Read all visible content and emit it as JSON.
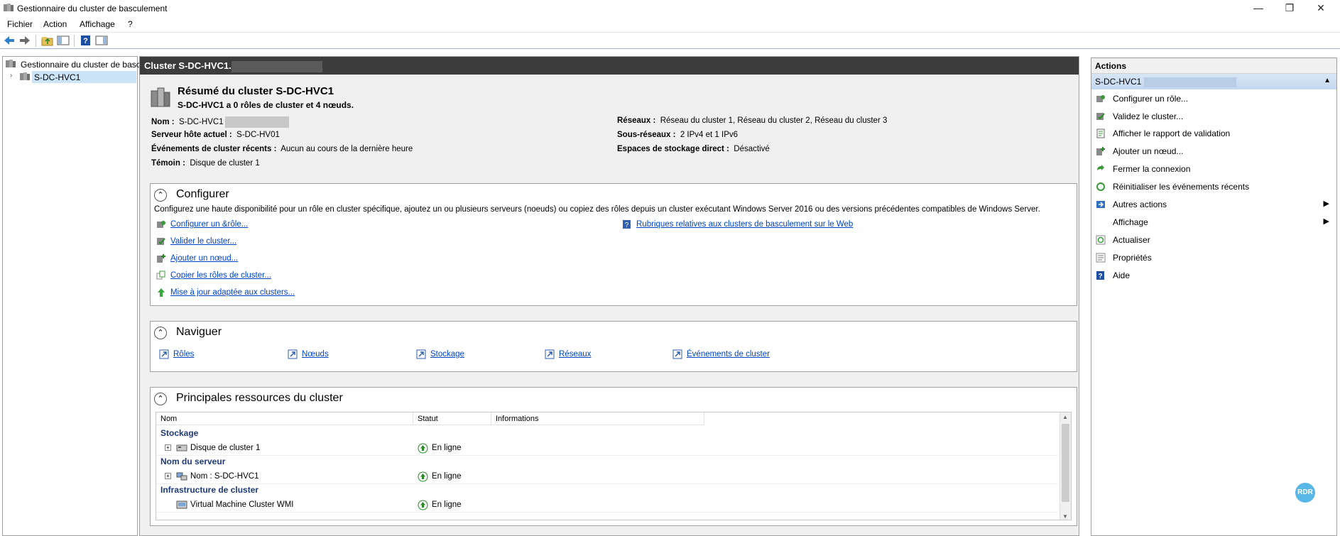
{
  "window": {
    "title": "Gestionnaire du cluster de basculement"
  },
  "menu": [
    "Fichier",
    "Action",
    "Affichage",
    "?"
  ],
  "tree": {
    "root": "Gestionnaire du cluster de basc",
    "child": "S-DC-HVC1"
  },
  "center": {
    "header": "Cluster S-DC-HVC1.",
    "summary_title": "Résumé du cluster S-DC-HVC1",
    "summary_sub": "S-DC-HVC1 a 0 rôles de cluster et 4 nœuds.",
    "left_fields": [
      {
        "k": "Nom :",
        "v": "S-DC-HVC1"
      },
      {
        "k": "Serveur hôte actuel :",
        "v": "S-DC-HV01"
      },
      {
        "k": "Événements de cluster récents :",
        "v": "Aucun au cours de la dernière heure"
      },
      {
        "k": "Témoin :",
        "v": "Disque de cluster 1"
      }
    ],
    "right_fields": [
      {
        "k": "Réseaux :",
        "v": "Réseau du cluster 1, Réseau du cluster 2, Réseau du cluster 3"
      },
      {
        "k": "Sous-réseaux :",
        "v": "2 IPv4 et 1 IPv6"
      },
      {
        "k": "Espaces de stockage direct :",
        "v": "Désactivé"
      }
    ],
    "configure": {
      "title": "Configurer",
      "desc": "Configurez une haute disponibilité pour un rôle en cluster spécifique, ajoutez un ou plusieurs serveurs (noeuds) ou copiez des rôles depuis un cluster exécutant Windows Server 2016 ou des versions précédentes compatibles de Windows Server.",
      "links": [
        "Configurer un &rôle...",
        "Valider le cluster...",
        "Ajouter un nœud...",
        "Copier les rôles de cluster...",
        "Mise à jour adaptée aux clusters..."
      ],
      "web_link": "Rubriques relatives aux clusters de basculement sur le Web"
    },
    "navigate": {
      "title": "Naviguer",
      "links": [
        "Rôles",
        "Nœuds",
        "Stockage",
        "Réseaux",
        "Événements de cluster"
      ]
    },
    "resources": {
      "title": "Principales ressources du cluster",
      "columns": [
        "Nom",
        "Statut",
        "Informations"
      ],
      "groups": [
        {
          "name": "Stockage",
          "items": [
            {
              "name": "Disque de cluster 1",
              "status": "En ligne"
            }
          ]
        },
        {
          "name": "Nom du serveur",
          "items": [
            {
              "name": "Nom : S-DC-HVC1",
              "status": "En ligne"
            }
          ]
        },
        {
          "name": "Infrastructure de cluster",
          "items": [
            {
              "name": "Virtual Machine Cluster WMI",
              "status": "En ligne"
            }
          ]
        }
      ]
    }
  },
  "actions": {
    "title": "Actions",
    "context": "S-DC-HVC1",
    "items": [
      {
        "label": "Configurer un rôle...",
        "icon": "configure-role-icon"
      },
      {
        "label": "Validez le cluster...",
        "icon": "validate-icon"
      },
      {
        "label": "Afficher le rapport de validation",
        "icon": "report-icon"
      },
      {
        "label": "Ajouter un nœud...",
        "icon": "add-node-icon"
      },
      {
        "label": "Fermer la connexion",
        "icon": "close-connection-icon"
      },
      {
        "label": "Réinitialiser les événements récents",
        "icon": "reset-icon"
      },
      {
        "label": "Autres actions",
        "icon": "more-actions-icon"
      },
      {
        "label": "Affichage",
        "icon": ""
      },
      {
        "label": "Actualiser",
        "icon": "refresh-icon"
      },
      {
        "label": "Propriétés",
        "icon": "properties-icon"
      },
      {
        "label": "Aide",
        "icon": "help-icon"
      }
    ]
  },
  "badge": "RDR"
}
